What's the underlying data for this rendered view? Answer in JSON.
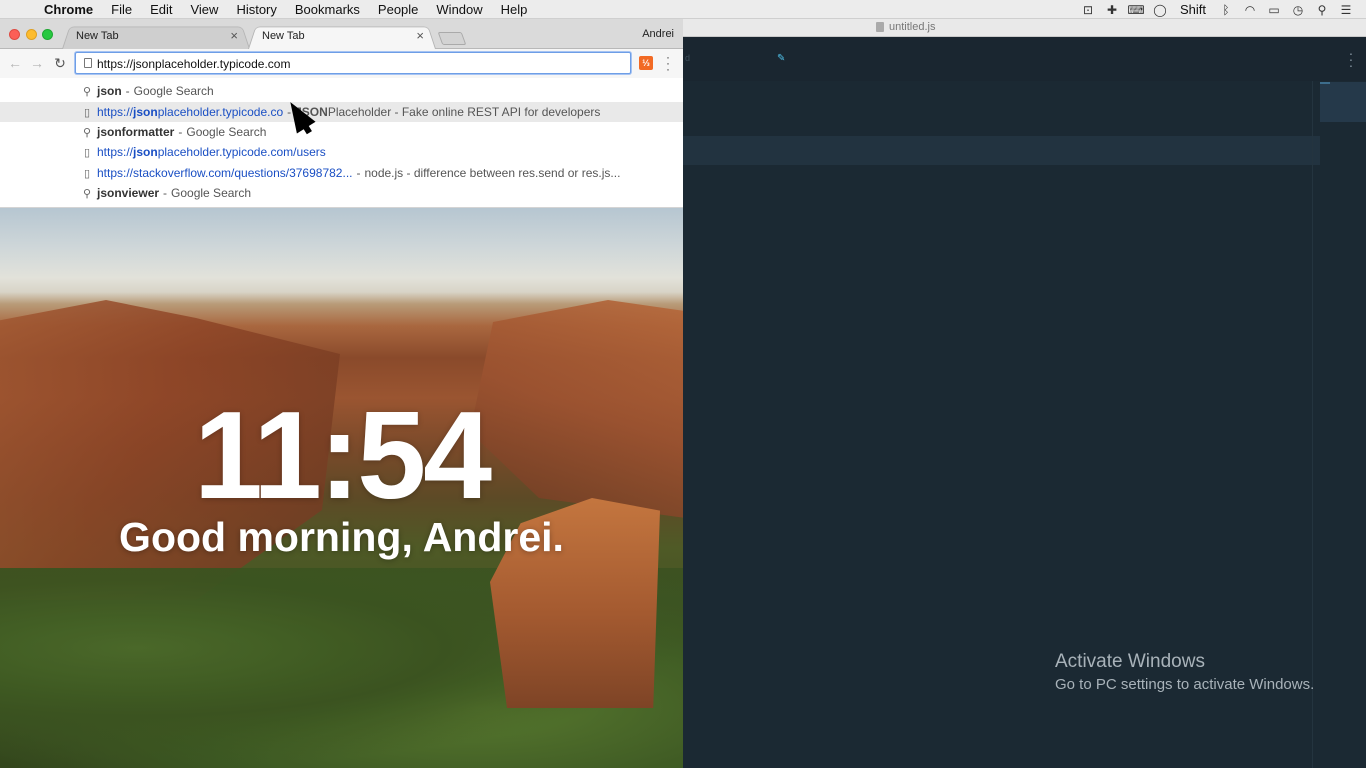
{
  "menubar": {
    "app": "Chrome",
    "items": [
      "File",
      "Edit",
      "View",
      "History",
      "Bookmarks",
      "People",
      "Window",
      "Help"
    ],
    "tray_text": "Shift"
  },
  "browser": {
    "tabs": [
      {
        "label": "New Tab"
      },
      {
        "label": "New Tab"
      }
    ],
    "profile": "Andrei",
    "omnibox_value": "https://jsonplaceholder.typicode.com",
    "suggestions": [
      {
        "q": "json",
        "q_rest": "",
        "sep": "-",
        "desc": "Google Search"
      },
      {
        "url_pre": "https://",
        "url_bold": "json",
        "url_post": "placeholder.typicode.co",
        "sep": "-",
        "desc_bold": "JSON",
        "desc": "Placeholder - Fake online REST API for developers"
      },
      {
        "q": "json",
        "q_rest": " formatter",
        "sep": "-",
        "desc": "Google Search"
      },
      {
        "url_pre": "https://",
        "url_bold": "json",
        "url_post": "placeholder.typicode.com/users",
        "sep": "",
        "desc_bold": "",
        "desc": ""
      },
      {
        "url_pre": "https://stackoverflow.com/questions/37698782...",
        "url_bold": "",
        "url_post": "",
        "sep": "-",
        "desc_bold": "",
        "desc": "node.js - difference between res.send or res.js..."
      },
      {
        "q": "json",
        "q_rest": " viewer",
        "sep": "-",
        "desc": "Google Search"
      }
    ],
    "new_tab_page": {
      "time": "11:54",
      "greeting": "Good morning, Andrei."
    }
  },
  "editor": {
    "title": "untitled.js",
    "tab_fragment": "d"
  },
  "watermark": {
    "line1": "Activate Windows",
    "line2": "Go to PC settings to activate Windows."
  }
}
